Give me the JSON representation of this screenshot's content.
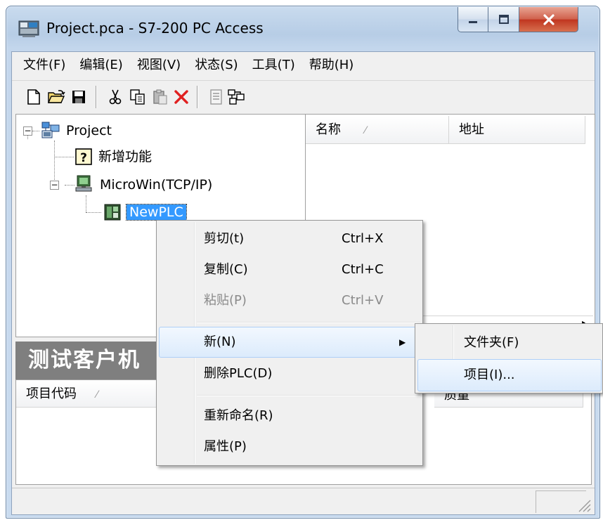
{
  "window": {
    "title": "Project.pca - S7-200 PC Access",
    "minimize_glyph": "—",
    "close_glyph": "X"
  },
  "menubar": {
    "items": [
      "文件(F)",
      "编辑(E)",
      "视图(V)",
      "状态(S)",
      "工具(T)",
      "帮助(H)"
    ]
  },
  "toolbar": {
    "icons": [
      "new-file-icon",
      "open-folder-icon",
      "save-icon",
      "cut-icon",
      "copy-icon",
      "paste-icon",
      "delete-icon",
      "properties-icon",
      "network-icon"
    ]
  },
  "tree": {
    "root": "Project",
    "new_features": "新增功能",
    "microwin": "MicroWin(TCP/IP)",
    "plc": "NewPLC",
    "expanded_glyph": "−"
  },
  "list": {
    "columns": [
      "名称",
      "地址"
    ]
  },
  "test_client": {
    "title": "测试客户机",
    "columns": [
      "项目代码",
      "质量"
    ]
  },
  "context_menu": {
    "items": [
      {
        "label": "剪切(t)",
        "shortcut": "Ctrl+X",
        "enabled": true
      },
      {
        "label": "复制(C)",
        "shortcut": "Ctrl+C",
        "enabled": true
      },
      {
        "label": "粘贴(P)",
        "shortcut": "Ctrl+V",
        "enabled": false
      },
      {
        "label": "新(N)",
        "shortcut": "",
        "enabled": true,
        "submenu": true
      },
      {
        "label": "删除PLC(D)",
        "shortcut": "",
        "enabled": true
      },
      {
        "label": "重新命名(R)",
        "shortcut": "",
        "enabled": true
      },
      {
        "label": "属性(P)",
        "shortcut": "",
        "enabled": true
      }
    ],
    "submenu_arrow": "▶"
  },
  "submenu": {
    "items": [
      "文件夹(F)",
      "项目(I)..."
    ]
  },
  "sort_glyph": "⁄"
}
